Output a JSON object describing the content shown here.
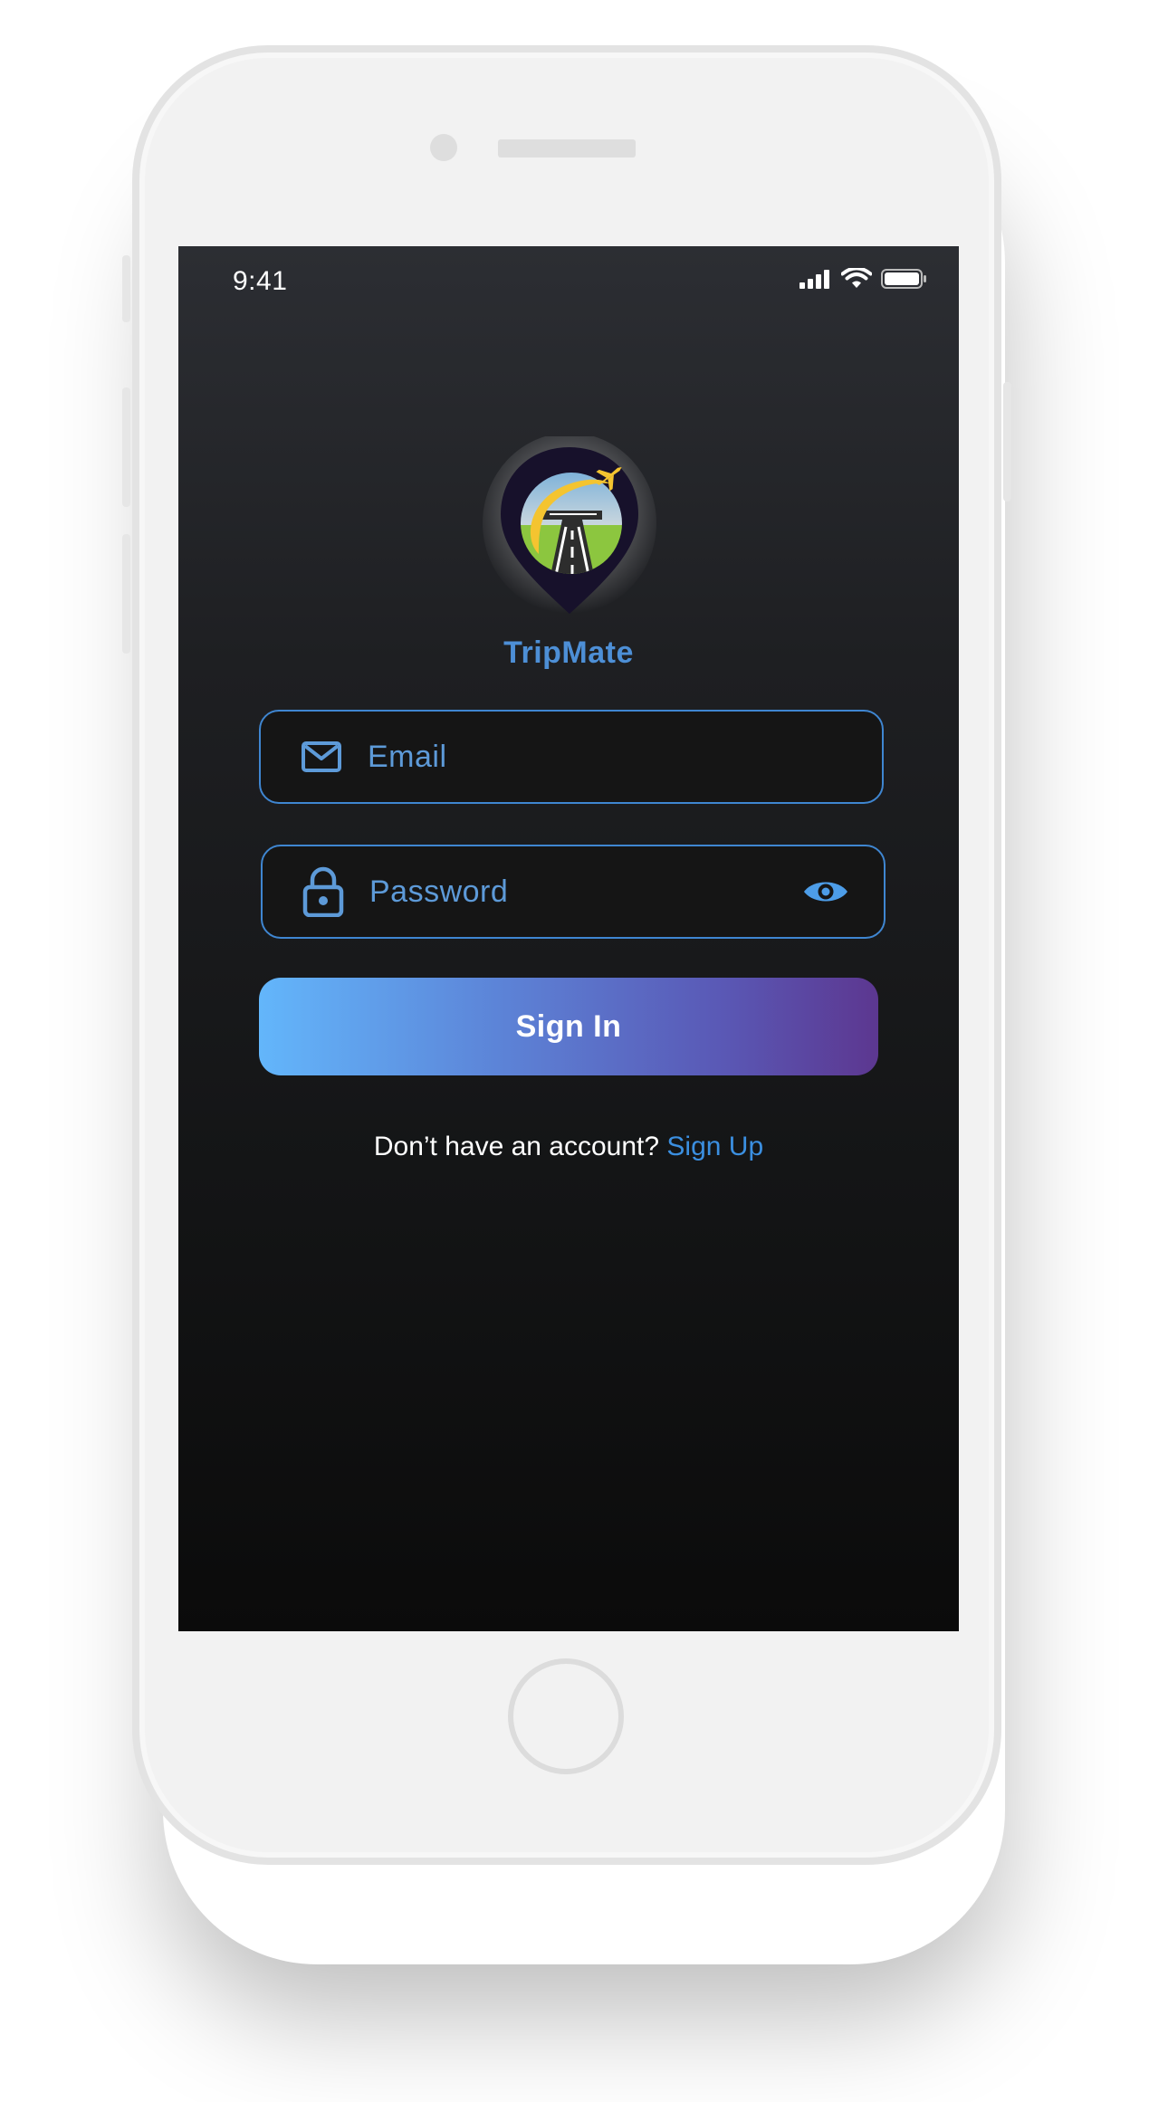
{
  "status_bar": {
    "time": "9:41",
    "icons": [
      "cellular-signal-icon",
      "wifi-icon",
      "battery-icon"
    ]
  },
  "app": {
    "name": "TripMate",
    "logo": "tripmate-logo"
  },
  "form": {
    "email": {
      "placeholder": "Email",
      "value": "",
      "icon": "envelope-icon"
    },
    "password": {
      "placeholder": "Password",
      "value": "",
      "icon": "lock-icon",
      "toggle_icon": "eye-icon"
    },
    "sign_in_label": "Sign In"
  },
  "footer": {
    "prompt": "Don’t have an account? ",
    "link": "Sign Up"
  },
  "colors": {
    "accent": "#3f86d1",
    "app_name": "#4d8fd6",
    "link": "#3b8fe0",
    "button_gradient_start": "#63b6fb",
    "button_gradient_end": "#5c3790",
    "background_top": "#2c2e33",
    "background_bottom": "#0b0b0b"
  }
}
